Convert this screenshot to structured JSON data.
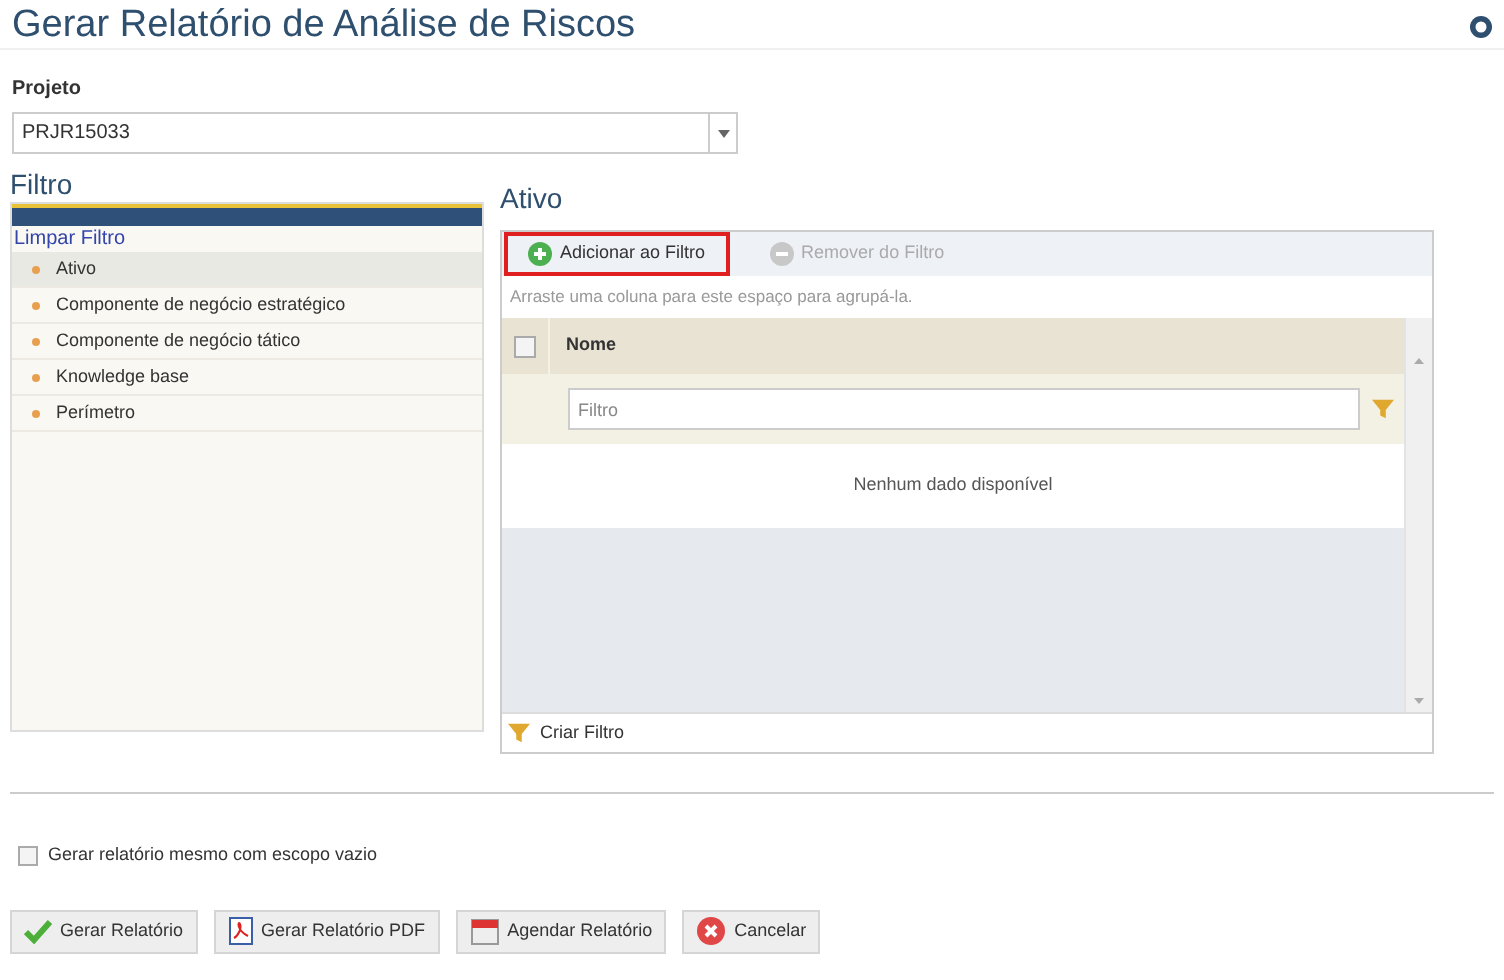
{
  "page": {
    "title": "Gerar Relatório de Análise de Riscos"
  },
  "project": {
    "label": "Projeto",
    "value": "PRJR15033"
  },
  "filter": {
    "title": "Filtro",
    "clear_link": "Limpar Filtro",
    "items": [
      {
        "label": "Ativo",
        "selected": true
      },
      {
        "label": "Componente de negócio estratégico",
        "selected": false
      },
      {
        "label": "Componente de negócio tático",
        "selected": false
      },
      {
        "label": "Knowledge base",
        "selected": false
      },
      {
        "label": "Perímetro",
        "selected": false
      }
    ]
  },
  "grid": {
    "title": "Ativo",
    "toolbar": [
      {
        "label": "Adicionar ao Filtro",
        "kind": "add",
        "disabled": false,
        "highlighted": true
      },
      {
        "label": "Remover do Filtro",
        "kind": "remove",
        "disabled": true,
        "highlighted": false
      }
    ],
    "group_hint": "Arraste uma coluna para este espaço para agrupá-la.",
    "header_checked": false,
    "column": "Nome",
    "filter_placeholder": "Filtro",
    "empty": "Nenhum dado disponível",
    "footer": "Criar Filtro"
  },
  "empty_scope": {
    "label": "Gerar relatório mesmo com escopo vazio",
    "checked": false
  },
  "buttons": [
    {
      "label": "Gerar Relatório",
      "kind": "check"
    },
    {
      "label": "Gerar Relatório PDF",
      "kind": "pdf"
    },
    {
      "label": "Agendar Relatório",
      "kind": "calendar"
    },
    {
      "label": "Cancelar",
      "kind": "cancel"
    }
  ]
}
